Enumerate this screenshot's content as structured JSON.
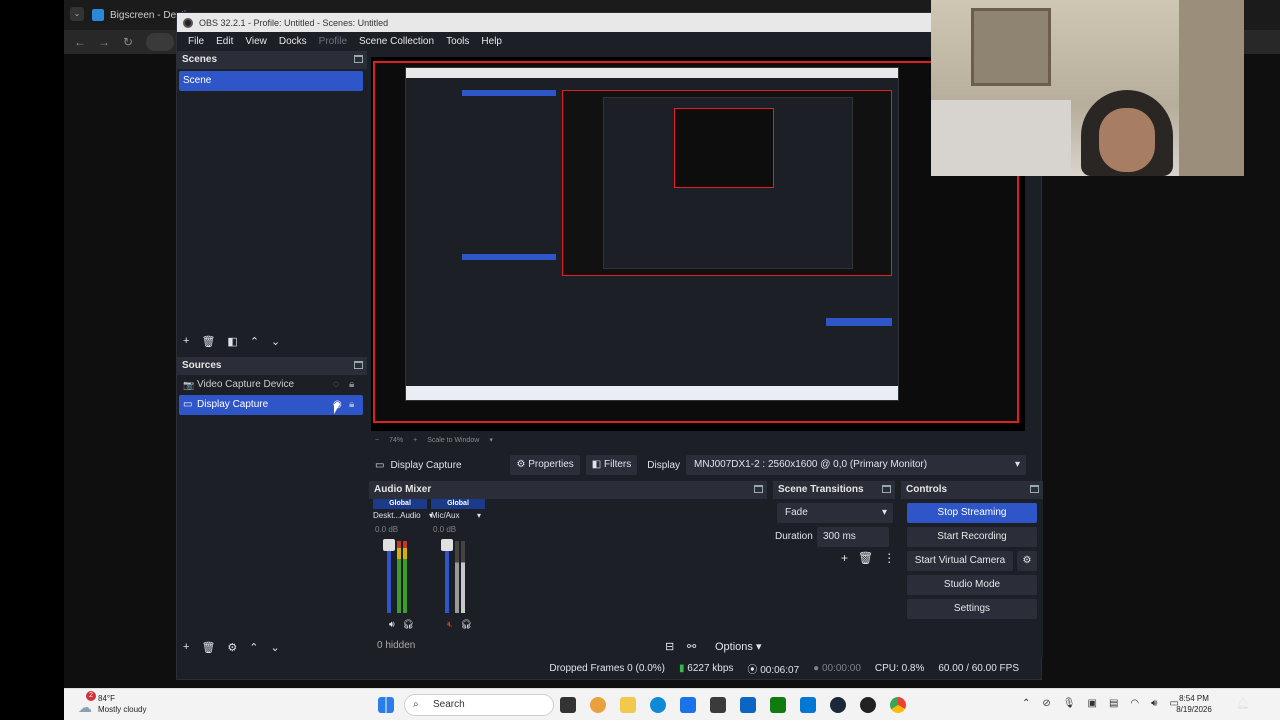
{
  "browser": {
    "tab_title": "Bigscreen - Desti",
    "nav_back": "←",
    "nav_forward": "→",
    "nav_reload": "↻"
  },
  "obs": {
    "title": "OBS 32.2.1 - Profile: Untitled - Scenes: Untitled",
    "menu": [
      "File",
      "Edit",
      "View",
      "Docks",
      "Profile",
      "Scene Collection",
      "Tools",
      "Help"
    ],
    "scenes": {
      "header": "Scenes",
      "items": [
        "Scene"
      ]
    },
    "sources": {
      "header": "Sources",
      "items": [
        "Video Capture Device",
        "Display Capture"
      ],
      "hidden_count": "0 hidden"
    },
    "preview": {
      "zoom": "74%",
      "scale_mode": "Scale to Window"
    },
    "properties_bar": {
      "source_name": "Display Capture",
      "properties_label": "Properties",
      "filters_label": "Filters",
      "display_label": "Display",
      "display_value": "MNJ007DX1-2 : 2560x1600 @ 0,0 (Primary Monitor)"
    },
    "audio_mixer": {
      "header": "Audio Mixer",
      "channels": [
        {
          "global": "Global",
          "name": "Deskt...Audio",
          "db": "0.0 dB"
        },
        {
          "global": "Global",
          "name": "Mic/Aux",
          "db": "0.0 dB"
        }
      ],
      "scale": [
        "0",
        "-6",
        "-12",
        "-18",
        "-24",
        "-30",
        "-36",
        "-42",
        "-48",
        "-54",
        "-60"
      ],
      "options_label": "Options"
    },
    "transitions": {
      "header": "Scene Transitions",
      "transition": "Fade",
      "duration_label": "Duration",
      "duration_value": "300 ms"
    },
    "controls": {
      "header": "Controls",
      "stop_streaming": "Stop Streaming",
      "start_recording": "Start Recording",
      "start_virtual_camera": "Start Virtual Camera",
      "studio_mode": "Studio Mode",
      "settings": "Settings"
    },
    "status": {
      "dropped_frames": "Dropped Frames 0 (0.0%)",
      "bitrate": "6227 kbps",
      "stream_time": "00:06:07",
      "record_time": "00:00:00",
      "cpu": "CPU: 0.8%",
      "fps": "60.00 / 60.00 FPS"
    }
  },
  "taskbar": {
    "weather_badge": "2",
    "temperature": "84°F",
    "weather": "Mostly cloudy",
    "search_placeholder": "Search",
    "time": "8:54 PM",
    "date": "8/19/2026"
  },
  "colors": {
    "accent": "#2f56c8",
    "panel": "#1d1f26",
    "header": "#2b2e38",
    "preview_border": "#e02020"
  }
}
